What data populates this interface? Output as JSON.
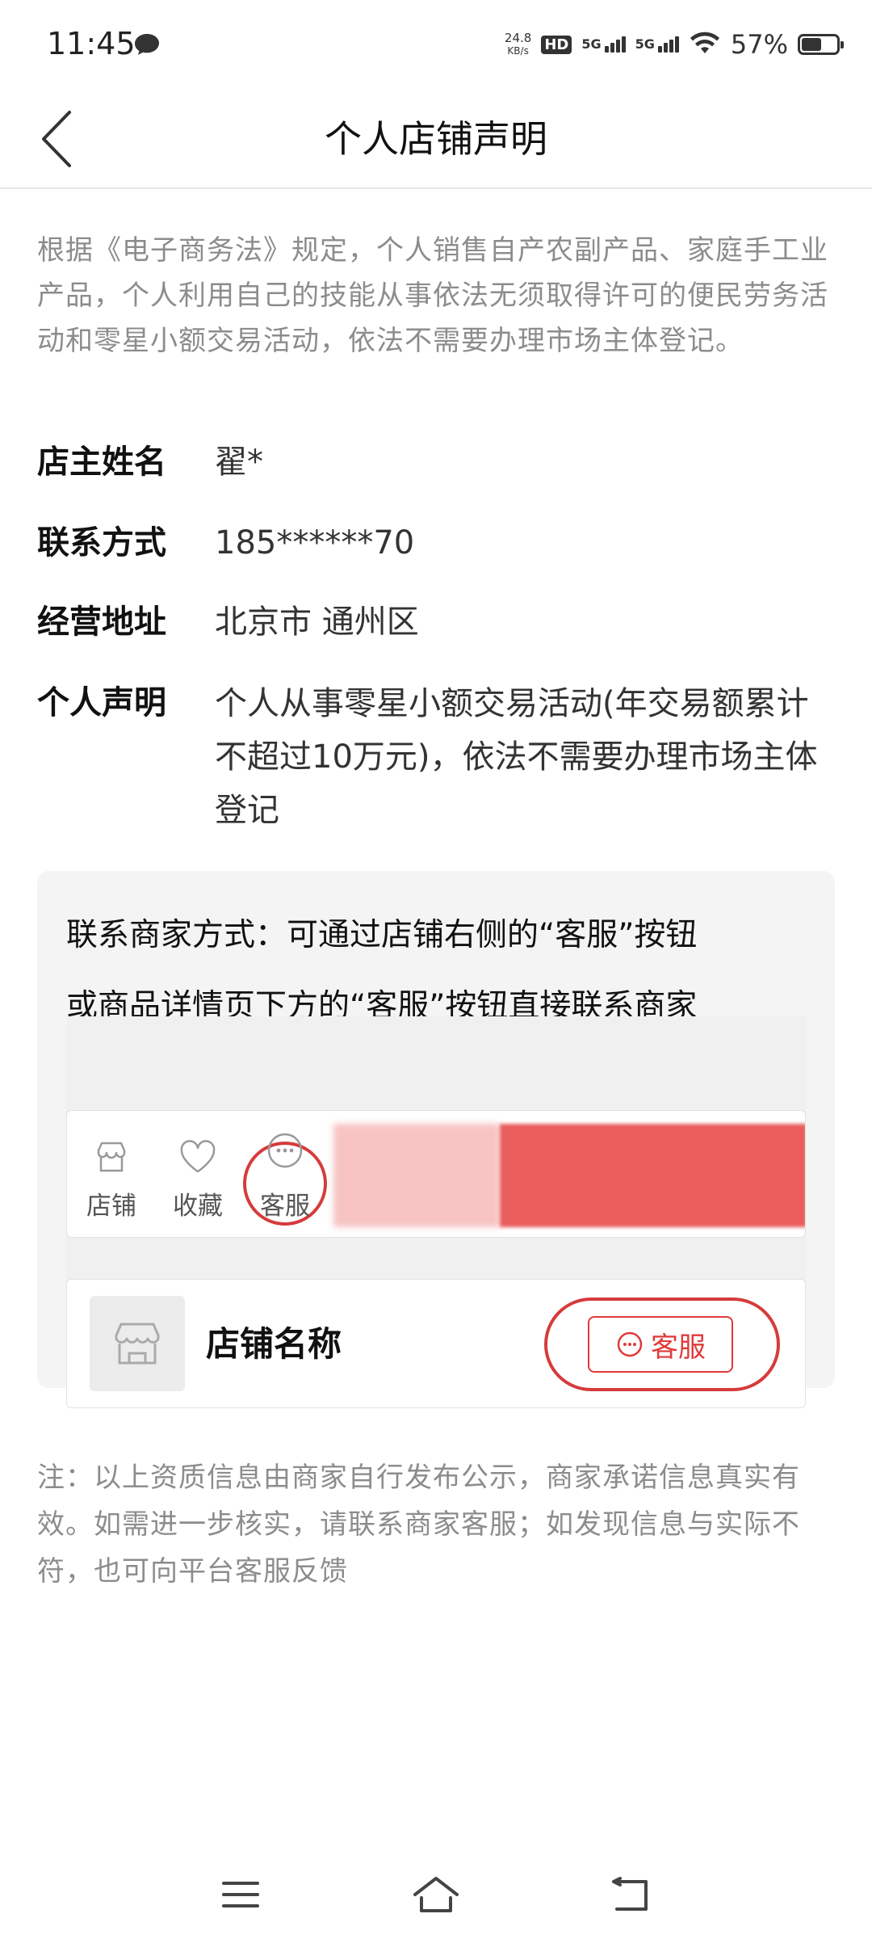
{
  "status_bar": {
    "time": "11:45",
    "net_speed_value": "24.8",
    "net_speed_unit": "KB/s",
    "hd_label": "HD",
    "signal_1_label": "5G",
    "signal_2_label": "5G",
    "battery_percent": "57%",
    "battery_level": 0.57
  },
  "header": {
    "title": "个人店铺声明"
  },
  "intro_text": "根据《电子商务法》规定，个人销售自产农副产品、家庭手工业产品，个人利用自己的技能从事依法无须取得许可的便民劳务活动和零星小额交易活动，依法不需要办理市场主体登记。",
  "info": [
    {
      "label": "店主姓名",
      "value": "翟*"
    },
    {
      "label": "联系方式",
      "value": "185******70"
    },
    {
      "label": "经营地址",
      "value": "北京市 通州区"
    },
    {
      "label": "个人声明",
      "value": "个人从事零星小额交易活动(年交易额累计不超过10万元)，依法不需要办理市场主体登记"
    }
  ],
  "contact": {
    "line1": "联系商家方式：可通过店铺右侧的“客服”按钮",
    "line2": "或商品详情页下方的“客服”按钮直接联系商家",
    "demo_bar": {
      "shop_label": "店铺",
      "fav_label": "收藏",
      "cs_label": "客服"
    },
    "shop_card": {
      "name": "店铺名称",
      "cs_label": "客服"
    }
  },
  "note_text": "注：以上资质信息由商家自行发布公示，商家承诺信息真实有效。如需进一步核实，请联系商家客服；如发现信息与实际不符，也可向平台客服反馈",
  "colors": {
    "accent_red": "#e03a3a",
    "muted_text": "#8c8c8c"
  }
}
